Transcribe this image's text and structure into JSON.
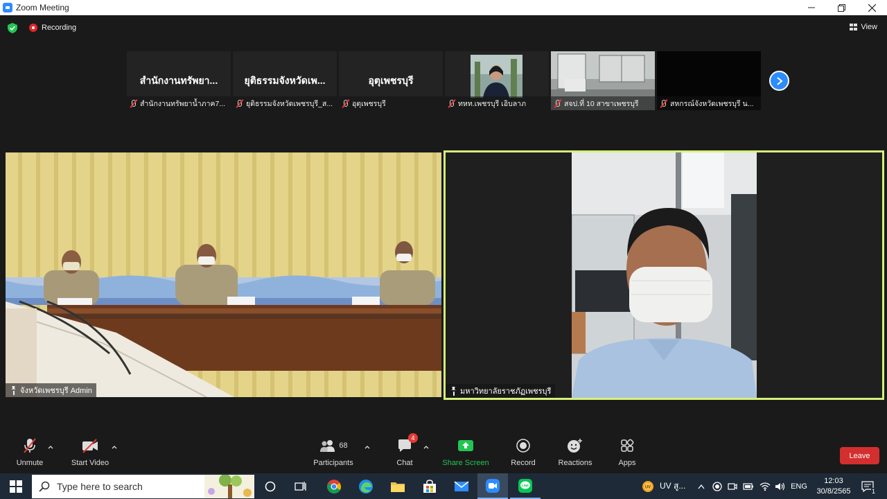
{
  "window": {
    "title": "Zoom Meeting"
  },
  "status": {
    "recording": "Recording",
    "view": "View"
  },
  "thumbnails": [
    {
      "big": "สำนักงานทรัพยา...",
      "caption": "สำนักงานทรัพยาน้ำภาค7..."
    },
    {
      "big": "ยุติธรรมจังหวัดเพ...",
      "caption": "ยุติธรรมจังหวัดเพชรบุรี_ส..."
    },
    {
      "big": "อุตุเพชรบุรี",
      "caption": "อุตุเพชรบุรี"
    },
    {
      "big": "",
      "caption": "ทหท.เพชรบุรี เอิบลาภ"
    },
    {
      "big": "",
      "caption": "สจป.ที่ 10 สาขาเพชรบุรี"
    },
    {
      "big": "",
      "caption": "สหกรณ์จังหวัดเพชรบุรี น..."
    }
  ],
  "main": {
    "left_caption": "จังหวัดเพชรบุรี Admin",
    "right_caption": "มหาวิทยาลัยราชภัฏเพชรบุรี"
  },
  "toolbar": {
    "unmute": "Unmute",
    "start_video": "Start Video",
    "participants": "Participants",
    "participants_count": "68",
    "chat": "Chat",
    "chat_badge": "4",
    "share_screen": "Share Screen",
    "record": "Record",
    "reactions": "Reactions",
    "apps": "Apps",
    "leave": "Leave"
  },
  "taskbar": {
    "search_placeholder": "Type here to search",
    "weather": "UV สู...",
    "language": "ENG",
    "time": "12:03",
    "date": "30/8/2565",
    "notification_count": "1"
  },
  "colors": {
    "zoom_blue": "#2d8cff",
    "active_speaker_border": "#d6f07a",
    "leave_red": "#d32f2f",
    "share_green": "#23c552"
  }
}
